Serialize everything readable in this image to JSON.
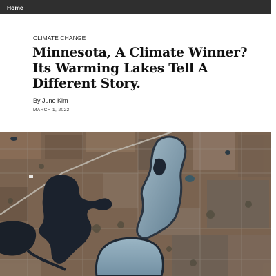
{
  "nav": {
    "home_label": "Home"
  },
  "article": {
    "category": "CLIMATE CHANGE",
    "headline": "Minnesota, A Climate Winner? Its Warming Lakes Tell A Different Story.",
    "byline_prefix": "By ",
    "author": "June Kim",
    "date": "MARCH 1, 2022"
  },
  "hero_image": {
    "description_icon": "aerial-lakes-image"
  },
  "colors": {
    "nav_background": "#2f2f2f",
    "text": "#111111",
    "land": "#7a6350",
    "lake_dark": "#1c2330",
    "lake_light": "#8ea6b6"
  }
}
